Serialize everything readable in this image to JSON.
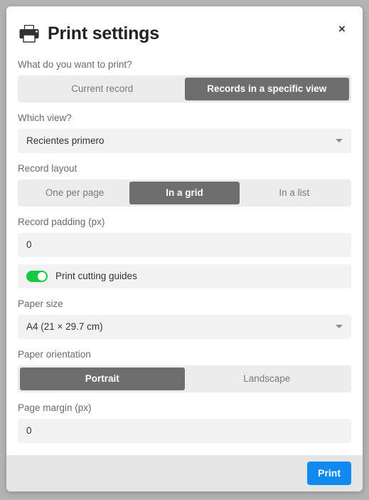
{
  "dialog": {
    "title": "Print settings",
    "icon": "printer-icon",
    "close_label": "×"
  },
  "fields": {
    "what_to_print": {
      "label": "What do you want to print?",
      "options": [
        "Current record",
        "Records in a specific view"
      ],
      "selected_index": 1
    },
    "which_view": {
      "label": "Which view?",
      "value": "Recientes primero"
    },
    "record_layout": {
      "label": "Record layout",
      "options": [
        "One per page",
        "In a grid",
        "In a list"
      ],
      "selected_index": 1
    },
    "record_padding": {
      "label": "Record padding (px)",
      "value": "0",
      "placeholder": "0"
    },
    "cutting_guides": {
      "label": "Print cutting guides",
      "enabled": true
    },
    "paper_size": {
      "label": "Paper size",
      "value": "A4 (21 × 29.7 cm)"
    },
    "paper_orientation": {
      "label": "Paper orientation",
      "options": [
        "Portrait",
        "Landscape"
      ],
      "selected_index": 0
    },
    "page_margin": {
      "label": "Page margin (px)",
      "value": "0",
      "placeholder": "0"
    }
  },
  "footer": {
    "print_label": "Print"
  },
  "colors": {
    "accent": "#1089f0",
    "toggle_on": "#15c943",
    "segment_active": "#6e6e6e",
    "backdrop": "#b3b3b3"
  }
}
